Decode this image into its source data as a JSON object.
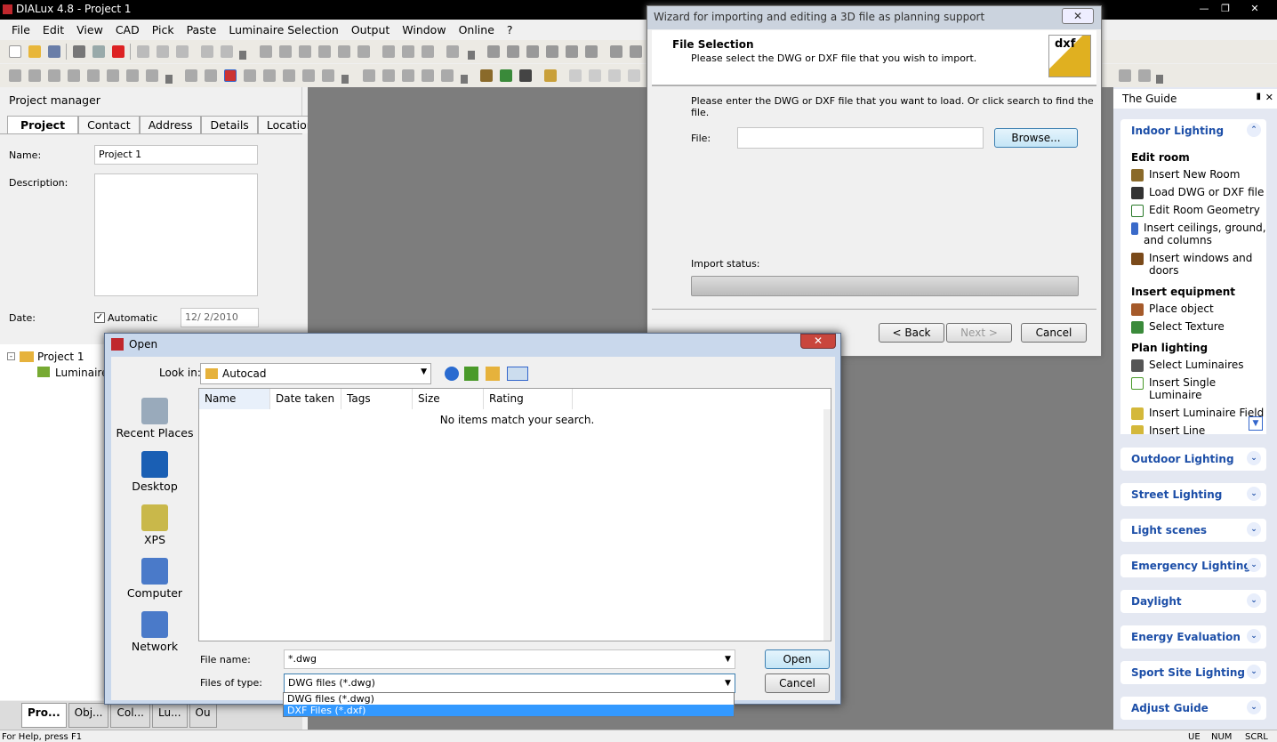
{
  "app": {
    "title": "DIALux 4.8 - Project 1"
  },
  "menu": [
    "File",
    "Edit",
    "View",
    "CAD",
    "Pick",
    "Paste",
    "Luminaire Selection",
    "Output",
    "Window",
    "Online",
    "?"
  ],
  "project_manager": {
    "header": "Project manager",
    "tabs": [
      "Project",
      "Contact",
      "Address",
      "Details",
      "Location"
    ],
    "name_label": "Name:",
    "name_value": "Project 1",
    "description_label": "Description:",
    "date_label": "Date:",
    "automatic_label": "Automatic",
    "date_value": "12/ 2/2010",
    "tree": [
      "Project 1",
      "Luminaire"
    ]
  },
  "bottom_tabs": [
    "Pro...",
    "Obj...",
    "Col...",
    "Lu...",
    "Ou"
  ],
  "statusbar": {
    "text": "For Help, press F1",
    "ue": "UE",
    "num": "NUM",
    "scrl": "SCRL"
  },
  "wizard": {
    "title": "Wizard for importing and editing a 3D file as planning support",
    "head_title": "File Selection",
    "head_sub": "Please select the DWG or DXF file that you wish to import.",
    "instruction": "Please enter the DWG or DXF file that you want to load. Or click search to find the file.",
    "file_label": "File:",
    "browse": "Browse...",
    "import_status": "Import status:",
    "back": "< Back",
    "next": "Next >",
    "cancel": "Cancel",
    "logo": "dxf"
  },
  "open_dialog": {
    "title": "Open",
    "look_in_label": "Look in:",
    "look_in_value": "Autocad",
    "places": [
      "Recent Places",
      "Desktop",
      "XPS",
      "Computer",
      "Network"
    ],
    "columns": [
      "Name",
      "Date taken",
      "Tags",
      "Size",
      "Rating"
    ],
    "empty": "No items match your search.",
    "file_name_label": "File name:",
    "file_name_value": "*.dwg",
    "files_of_type_label": "Files of type:",
    "files_of_type_value": "DWG files (*.dwg)",
    "options": [
      "DWG files (*.dwg)",
      "DXF Files (*.dxf)"
    ],
    "open": "Open",
    "cancel": "Cancel"
  },
  "guide": {
    "title": "The Guide",
    "open_section": "Indoor Lighting",
    "groups": [
      {
        "title": "Edit room",
        "items": [
          "Insert New Room",
          "Load DWG or DXF file",
          "Edit Room Geometry",
          "Insert ceilings, ground, and columns",
          "Insert windows and doors"
        ]
      },
      {
        "title": "Insert equipment",
        "items": [
          "Place object",
          "Select Texture"
        ]
      },
      {
        "title": "Plan lighting",
        "items": [
          "Select Luminaires",
          "Insert Single Luminaire",
          "Insert Luminaire Field",
          "Insert Line"
        ]
      }
    ],
    "sections": [
      "Outdoor Lighting",
      "Street Lighting",
      "Light scenes",
      "Emergency Lighting",
      "Daylight",
      "Energy Evaluation",
      "Sport Site Lighting",
      "Adjust Guide"
    ]
  }
}
